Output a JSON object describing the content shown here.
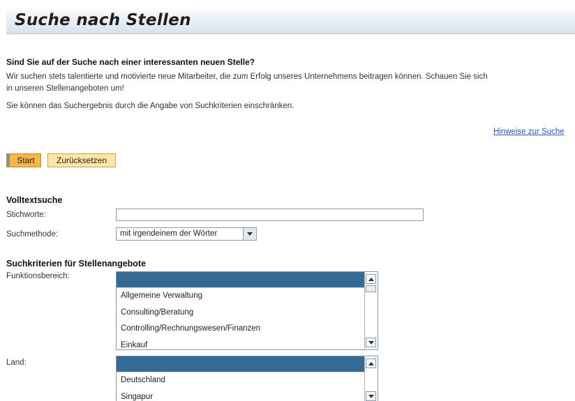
{
  "header": {
    "title": "Suche nach Stellen"
  },
  "intro": {
    "question": "Sind Sie auf der Suche nach einer interessanten neuen Stelle?",
    "paragraph_line1": "Wir suchen stets talentierte und motivierte neue Mitarbeiter, die zum Erfolg unseres Unternehmens beitragen können. Schauen Sie sich",
    "paragraph_line2": "in unseren Stellenangeboten um!",
    "paragraph2": "Sie können das Suchergebnis durch die Angabe von Suchkriterien einschränken."
  },
  "links": {
    "hints": "Hinweise zur Suche"
  },
  "buttons": {
    "start": "Start",
    "reset": "Zurücksetzen"
  },
  "fulltext": {
    "title": "Volltextsuche",
    "keywords_label": "Stichworte:",
    "keywords_value": "",
    "method_label": "Suchmethode:",
    "method_value": "mit irgendeinem der Wörter"
  },
  "criteria": {
    "title": "Suchkriterien für Stellenangebote",
    "function_label": "Funktionsbereich:",
    "function_options": [
      "Allgemeine Verwaltung",
      "Consulting/Beratung",
      "Controlling/Rechnungswesen/Finanzen",
      "Einkauf"
    ],
    "country_label": "Land:",
    "country_options": [
      "Deutschland",
      "Singapur"
    ]
  },
  "colors": {
    "selected_row": "#346a96",
    "start_button": "#f7b547",
    "reset_button": "#fde6a5",
    "link": "#2a55a8"
  }
}
